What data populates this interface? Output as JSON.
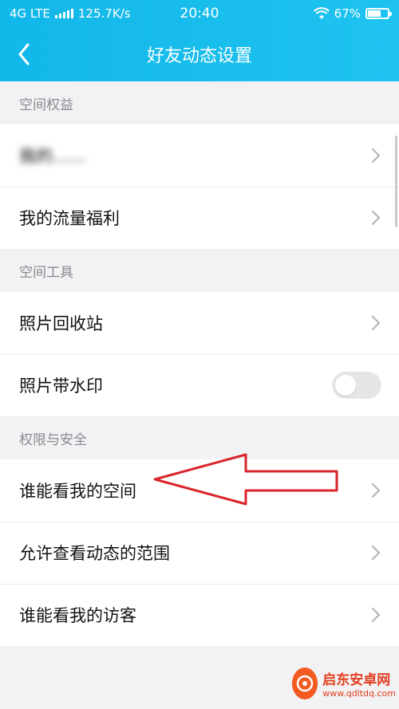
{
  "status_bar": {
    "network": "4G LTE",
    "speed": "125.7K/s",
    "time": "20:40",
    "battery": "67%",
    "battery_level": 0.67
  },
  "nav": {
    "title": "好友动态设置",
    "back_icon": "chevron-left-icon"
  },
  "sections": [
    {
      "header": "空间权益",
      "items": [
        {
          "label": "我的……",
          "control": "chevron",
          "blurred": true
        },
        {
          "label": "我的流量福利",
          "control": "chevron"
        }
      ]
    },
    {
      "header": "空间工具",
      "items": [
        {
          "label": "照片回收站",
          "control": "chevron"
        },
        {
          "label": "照片带水印",
          "control": "toggle",
          "toggle_on": false
        }
      ]
    },
    {
      "header": "权限与安全",
      "items": [
        {
          "label": "谁能看我的空间",
          "control": "chevron"
        },
        {
          "label": "允许查看动态的范围",
          "control": "chevron"
        },
        {
          "label": "谁能看我的访客",
          "control": "chevron"
        }
      ]
    }
  ],
  "annotation": {
    "color": "#d9262c"
  },
  "watermark": {
    "title": "启东安卓网",
    "url": "www.qdltdq.com"
  },
  "colors": {
    "header_bg": "#1ab9ec",
    "toggle_off": "#e6e6e9"
  }
}
